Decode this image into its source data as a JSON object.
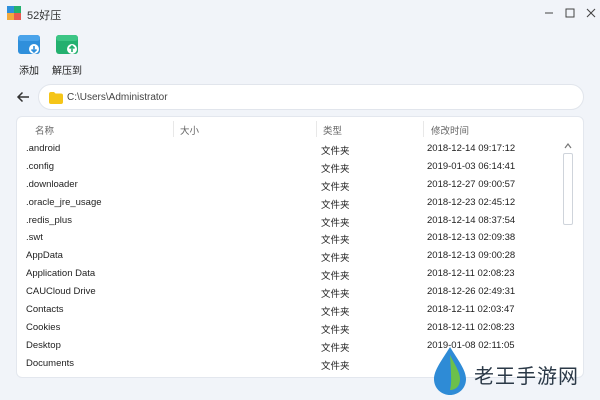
{
  "window": {
    "title": "52好压"
  },
  "toolbar": {
    "add_label": "添加",
    "extract_label": "解压到"
  },
  "address": {
    "path": "C:\\Users\\Administrator"
  },
  "list": {
    "columns": {
      "name": "名称",
      "size": "大小",
      "type": "类型",
      "modified": "修改时间"
    },
    "rows": [
      {
        "name": ".android",
        "type": "文件夹",
        "modified": "2018-12-14 09:17:12"
      },
      {
        "name": ".config",
        "type": "文件夹",
        "modified": "2019-01-03 06:14:41"
      },
      {
        "name": ".downloader",
        "type": "文件夹",
        "modified": "2018-12-27 09:00:57"
      },
      {
        "name": ".oracle_jre_usage",
        "type": "文件夹",
        "modified": "2018-12-23 02:45:12"
      },
      {
        "name": ".redis_plus",
        "type": "文件夹",
        "modified": "2018-12-14 08:37:54"
      },
      {
        "name": ".swt",
        "type": "文件夹",
        "modified": "2018-12-13 02:09:38"
      },
      {
        "name": "AppData",
        "type": "文件夹",
        "modified": "2018-12-13 09:00:28"
      },
      {
        "name": "Application Data",
        "type": "文件夹",
        "modified": "2018-12-11 02:08:23"
      },
      {
        "name": "CAUCloud Drive",
        "type": "文件夹",
        "modified": "2018-12-26 02:49:31"
      },
      {
        "name": "Contacts",
        "type": "文件夹",
        "modified": "2018-12-11 02:03:47"
      },
      {
        "name": "Cookies",
        "type": "文件夹",
        "modified": "2018-12-11 02:08:23"
      },
      {
        "name": "Desktop",
        "type": "文件夹",
        "modified": "2019-01-08 02:11:05"
      },
      {
        "name": "Documents",
        "type": "文件夹",
        "modified": ""
      }
    ]
  },
  "watermark": {
    "text": "老王手游网"
  },
  "colors": {
    "accent_blue": "#2f8fdb",
    "accent_green": "#23b06f",
    "folder_yellow": "#f5c518"
  },
  "icons": {
    "add": "archive-add-icon",
    "extract": "archive-extract-icon",
    "back": "back-arrow-icon",
    "folder": "folder-icon"
  }
}
